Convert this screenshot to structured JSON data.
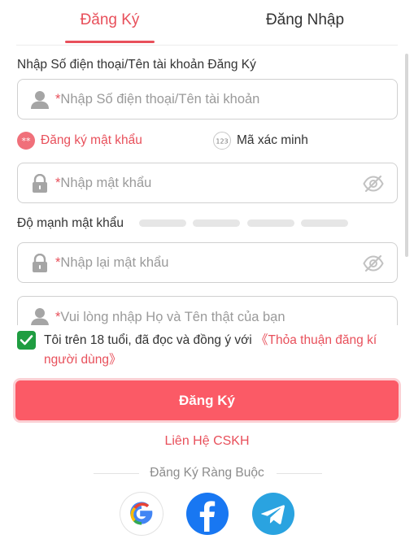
{
  "tabs": {
    "register": "Đăng Ký",
    "login": "Đăng Nhập"
  },
  "account": {
    "label": "Nhập Số điện thoại/Tên tài khoản Đăng Ký",
    "required_mark": "*",
    "placeholder": "Nhập Số điện thoại/Tên tài khoản"
  },
  "options": {
    "password_mode": "Đăng ký mật khẩu",
    "code_icon": "123",
    "code_mode": "Mã xác minh"
  },
  "password": {
    "required_mark": "*",
    "placeholder": "Nhập mật khẩu"
  },
  "strength": {
    "label": "Độ mạnh mật khẩu",
    "levels_filled": 0,
    "levels_total": 4
  },
  "confirm_password": {
    "required_mark": "*",
    "placeholder": "Nhập lại mật khẩu"
  },
  "full_name": {
    "required_mark": "*",
    "placeholder": "Vui lòng nhập Họ và Tên thật của bạn"
  },
  "agreement": {
    "checked": true,
    "text": "Tôi trên 18 tuổi, đã đọc và đồng ý với ",
    "link": "《Thỏa thuận đăng kí người dùng》"
  },
  "submit_label": "Đăng Ký",
  "contact_label": "Liên Hệ CSKH",
  "binding": {
    "title": "Đăng Ký Ràng Buộc"
  },
  "colors": {
    "accent": "#e8505b",
    "button": "#fb5a66",
    "checkbox": "#1f9d41",
    "facebook": "#1877f2",
    "telegram": "#2aa3e0"
  },
  "icons": [
    "user-icon",
    "lock-icon",
    "eye-off-icon",
    "password-dots-icon",
    "code-123-icon",
    "checkmark-icon",
    "google-icon",
    "facebook-icon",
    "telegram-icon"
  ]
}
